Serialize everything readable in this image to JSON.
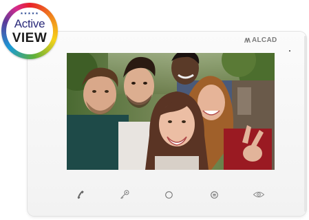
{
  "badge": {
    "word_top": "Active",
    "word_bottom": "VIEW",
    "stars": "★★★★★",
    "colors": [
      "#e8202a",
      "#f08a1c",
      "#f6d21b",
      "#5fb03a",
      "#1a9ad7",
      "#5a3c9a",
      "#d62a8c"
    ]
  },
  "device": {
    "brand": "ALCAD",
    "body_color": "#f6f6f6",
    "icon_color": "#8a8a8a",
    "screen_content": "video-call-selfie-image"
  },
  "buttons": [
    {
      "name": "handset-button",
      "icon": "handset-icon"
    },
    {
      "name": "door-key-button",
      "icon": "key-icon"
    },
    {
      "name": "home-button",
      "icon": "circle-icon"
    },
    {
      "name": "menu-button",
      "icon": "menu-icon"
    },
    {
      "name": "view-button",
      "icon": "eye-icon"
    }
  ]
}
